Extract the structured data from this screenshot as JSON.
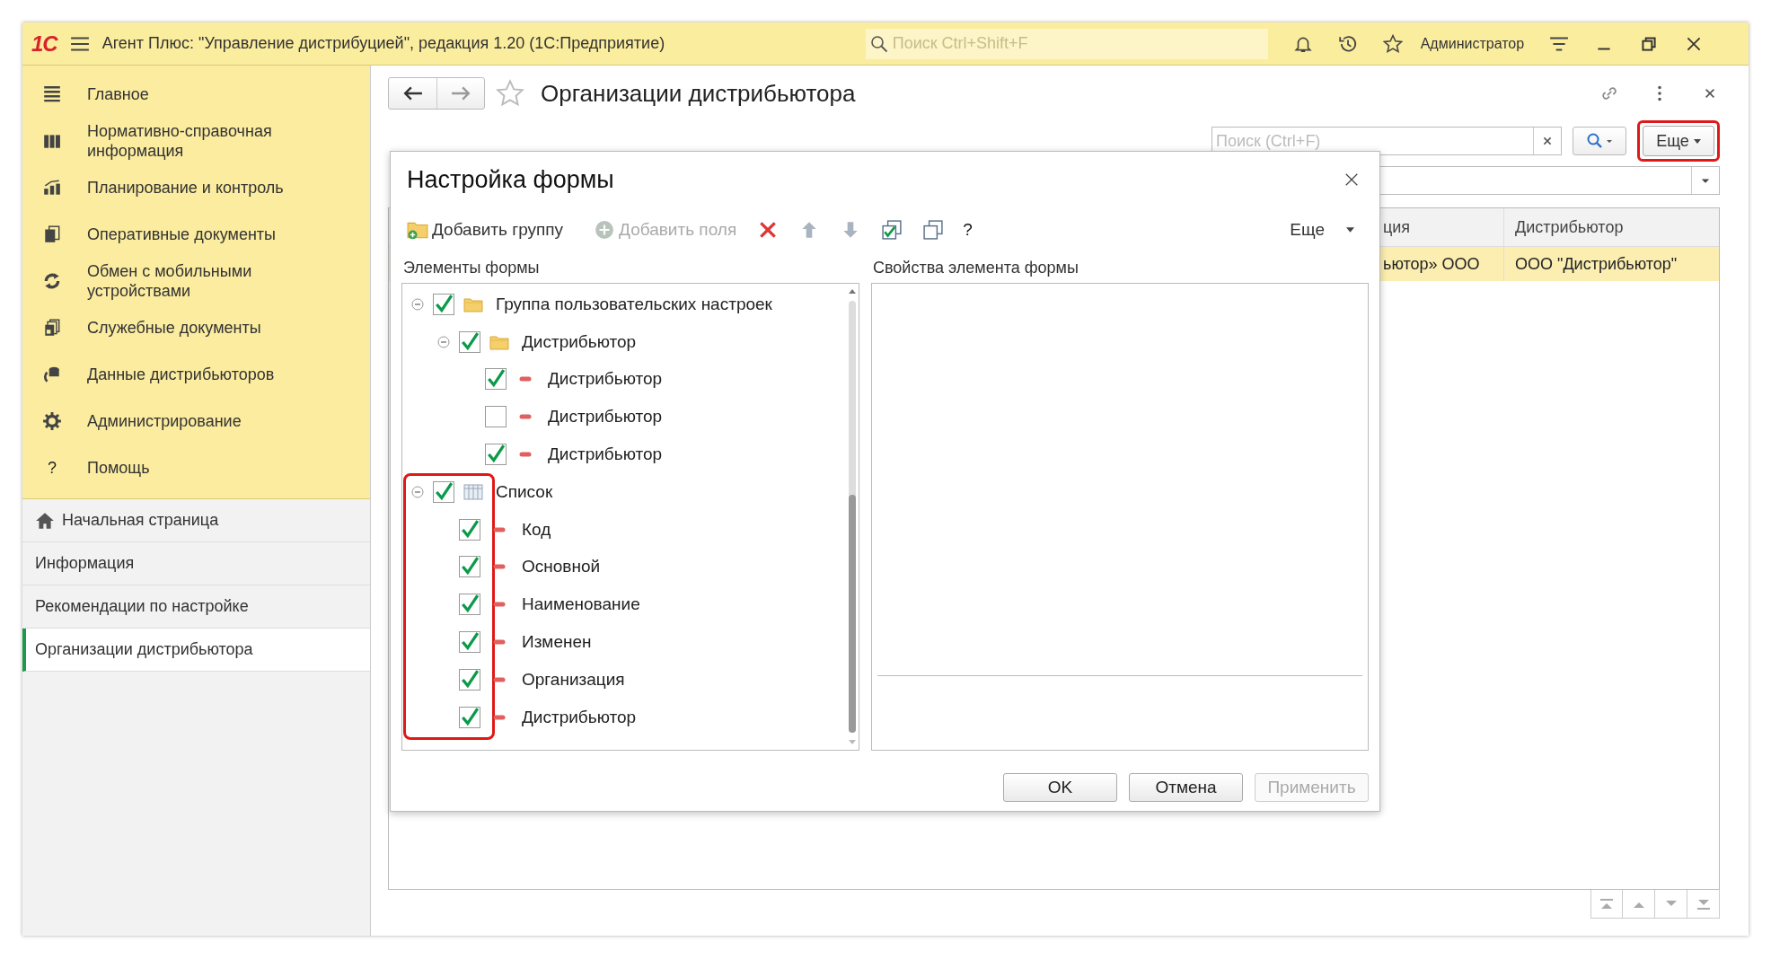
{
  "app": {
    "logo": "1С",
    "title": "Агент Плюс: \"Управление дистрибуцией\", редакция 1.20  (1С:Предприятие)",
    "search_placeholder": "Поиск Ctrl+Shift+F",
    "user": "Администратор"
  },
  "sections": [
    {
      "label": "Главное"
    },
    {
      "label": "Нормативно-справочная информация"
    },
    {
      "label": "Планирование и контроль"
    },
    {
      "label": "Оперативные документы"
    },
    {
      "label": "Обмен с мобильными устройствами"
    },
    {
      "label": "Служебные документы"
    },
    {
      "label": "Данные дистрибьюторов"
    },
    {
      "label": "Администрирование"
    },
    {
      "label": "Помощь",
      "icon_text": "?"
    }
  ],
  "open_pages": [
    {
      "label": "Начальная страница",
      "kind": "home",
      "selected": false
    },
    {
      "label": "Информация",
      "kind": "page",
      "selected": false
    },
    {
      "label": "Рекомендации по настройке",
      "kind": "page",
      "selected": false
    },
    {
      "label": "Организации дистрибьютора",
      "kind": "page",
      "selected": true
    }
  ],
  "page": {
    "title": "Организации дистрибьютора",
    "search_placeholder": "Поиск (Ctrl+F)",
    "more_button": {
      "label": "Еще",
      "highlighted": true
    },
    "table": {
      "columns": [
        "ция",
        "Дистрибьютор"
      ],
      "rows": [
        {
          "cells": [
            "ьютор» ООО",
            "ООО \"Дистрибьютор\""
          ],
          "selected": true
        }
      ]
    }
  },
  "dialog": {
    "title": "Настройка формы",
    "toolbar": [
      {
        "kind": "add-group",
        "label": "Добавить группу",
        "disabled": false
      },
      {
        "kind": "add-field",
        "label": "Добавить поля",
        "disabled": true
      },
      {
        "kind": "delete"
      },
      {
        "kind": "up"
      },
      {
        "kind": "down"
      },
      {
        "kind": "check-all"
      },
      {
        "kind": "uncheck-all"
      },
      {
        "kind": "help",
        "label": "?"
      }
    ],
    "more": "Еще",
    "left_label": "Элементы формы",
    "right_label": "Свойства элемента формы",
    "tree": [
      {
        "label": "Группа пользовательских настроек",
        "kind": "folder",
        "expanded": true,
        "checked": true,
        "children": [
          {
            "label": "Дистрибьютор",
            "kind": "folder",
            "expanded": true,
            "checked": true,
            "children": [
              {
                "label": "Дистрибьютор",
                "kind": "field",
                "checked": true
              },
              {
                "label": "Дистрибьютор",
                "kind": "field",
                "checked": false
              },
              {
                "label": "Дистрибьютор",
                "kind": "field",
                "checked": true
              }
            ]
          }
        ]
      },
      {
        "label": "Список",
        "kind": "table",
        "expanded": true,
        "checked": true,
        "highlighted": true,
        "children": [
          {
            "label": "Код",
            "kind": "field",
            "checked": true
          },
          {
            "label": "Основной",
            "kind": "field",
            "checked": true
          },
          {
            "label": "Наименование",
            "kind": "field",
            "checked": true
          },
          {
            "label": "Изменен",
            "kind": "field",
            "checked": true
          },
          {
            "label": "Организация",
            "kind": "field",
            "checked": true
          },
          {
            "label": "Дистрибьютор",
            "kind": "field",
            "checked": true
          }
        ]
      }
    ],
    "buttons": [
      {
        "label": "OK",
        "disabled": false
      },
      {
        "label": "Отмена",
        "disabled": false
      },
      {
        "label": "Применить",
        "disabled": true
      }
    ]
  }
}
